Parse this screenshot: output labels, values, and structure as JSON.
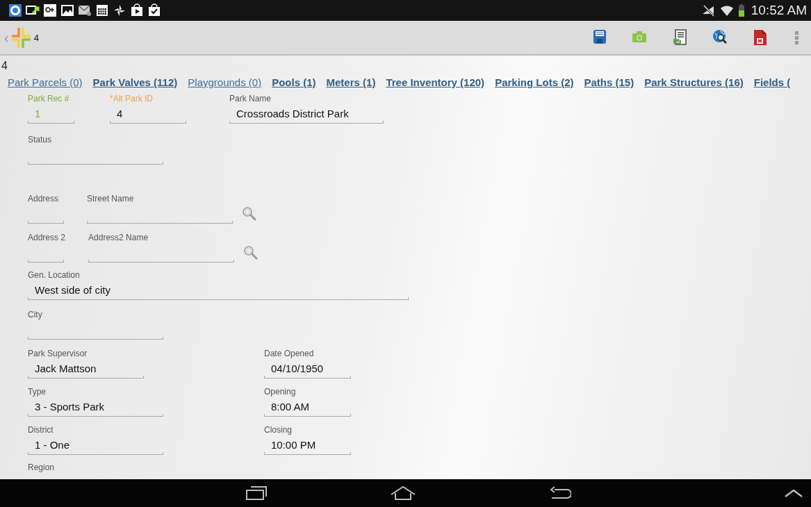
{
  "status_bar": {
    "time": "10:52 AM"
  },
  "action_bar": {
    "back": "‹",
    "title": "4"
  },
  "record_title": "4",
  "tabs": [
    {
      "label": "Park Parcels (0)",
      "emphasized": false
    },
    {
      "label": "Park Valves (112)",
      "emphasized": true
    },
    {
      "label": "Playgrounds (0)",
      "emphasized": false
    },
    {
      "label": "Pools (1)",
      "emphasized": true
    },
    {
      "label": "Meters (1)",
      "emphasized": true
    },
    {
      "label": "Tree Inventory (120)",
      "emphasized": true
    },
    {
      "label": "Parking Lots (2)",
      "emphasized": true
    },
    {
      "label": "Paths (15)",
      "emphasized": true
    },
    {
      "label": "Park Structures (16)",
      "emphasized": true
    },
    {
      "label": "Fields (",
      "emphasized": true
    }
  ],
  "form_rows": [
    [
      {
        "label": "Park Rec #",
        "value": "1",
        "kind": "text",
        "read_only": true,
        "required": false
      },
      {
        "label": "*Alt Park ID",
        "value": "4",
        "kind": "text",
        "read_only": false,
        "required": true
      },
      {
        "label": "Park Name",
        "value": "Crossroads District Park",
        "kind": "text",
        "read_only": false,
        "required": false
      }
    ],
    [
      {
        "label": "Status",
        "kind": "text",
        "read_only": false,
        "required": false
      }
    ],
    [
      {
        "label": "Address",
        "kind": "text",
        "read_only": false,
        "required": false
      },
      {
        "label": "Street Name",
        "kind": "lookup",
        "read_only": false,
        "required": false
      }
    ],
    [
      {
        "label": "Address 2",
        "kind": "text",
        "read_only": false,
        "required": false
      },
      {
        "label": "Address2 Name",
        "kind": "lookup",
        "read_only": false,
        "required": false
      }
    ],
    [
      {
        "label": "Gen. Location",
        "value": "West side of city",
        "kind": "text",
        "read_only": false,
        "required": false
      }
    ],
    [
      {
        "label": "City",
        "kind": "text",
        "read_only": false,
        "required": false
      }
    ],
    [
      {
        "label": "Park Supervisor",
        "value": "Jack Mattson",
        "kind": "text",
        "read_only": false,
        "required": false
      },
      {
        "label": "Date Opened",
        "value": "04/10/1950",
        "kind": "text",
        "read_only": false,
        "required": false
      }
    ],
    [
      {
        "label": "Type",
        "value": "3 - Sports Park",
        "kind": "text",
        "read_only": false,
        "required": false
      },
      {
        "label": "Opening",
        "value": "8:00 AM",
        "kind": "text",
        "read_only": false,
        "required": false
      }
    ],
    [
      {
        "label": "District",
        "value": "1 - One",
        "kind": "text",
        "read_only": false,
        "required": false
      },
      {
        "label": "Closing",
        "value": "10:00 PM",
        "kind": "text",
        "read_only": false,
        "required": false
      }
    ],
    [
      {
        "label": "Region",
        "kind": "label",
        "read_only": false,
        "required": false
      }
    ]
  ]
}
